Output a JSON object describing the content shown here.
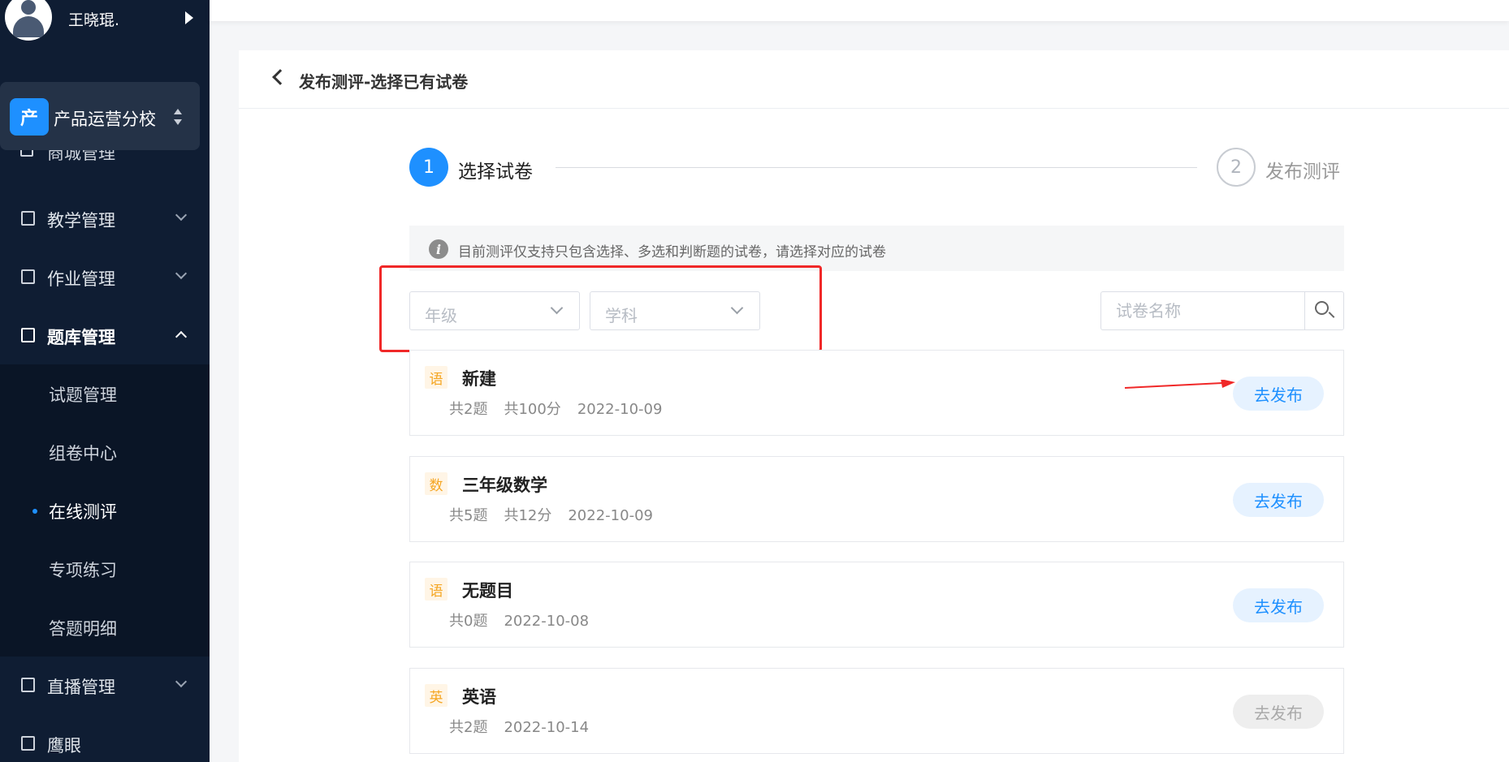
{
  "user": {
    "name": "王晓琨."
  },
  "school": {
    "badge": "产",
    "name": "产品运营分校"
  },
  "sidebar": {
    "cut_item": "商城管理",
    "menus": [
      {
        "label": "教学管理"
      },
      {
        "label": "作业管理"
      },
      {
        "label": "题库管理"
      },
      {
        "label": "直播管理"
      },
      {
        "label": "鹰眼"
      }
    ],
    "submenu": [
      {
        "label": "试题管理"
      },
      {
        "label": "组卷中心"
      },
      {
        "label": "在线测评"
      },
      {
        "label": "专项练习"
      },
      {
        "label": "答题明细"
      }
    ]
  },
  "page": {
    "title": "发布测评-选择已有试卷",
    "steps": [
      {
        "num": "1",
        "label": "选择试卷"
      },
      {
        "num": "2",
        "label": "发布测评"
      }
    ],
    "notice": "目前测评仅支持只包含选择、多选和判断题的试卷，请选择对应的试卷",
    "notice_icon": "i",
    "filters": {
      "grade": "年级",
      "subject": "学科",
      "search_placeholder": "试卷名称"
    }
  },
  "papers": [
    {
      "tag": "语",
      "name": "新建",
      "meta": [
        "共2题",
        "共100分",
        "2022-10-09"
      ],
      "button": "去发布",
      "enabled": true
    },
    {
      "tag": "数",
      "name": "三年级数学",
      "meta": [
        "共5题",
        "共12分",
        "2022-10-09"
      ],
      "button": "去发布",
      "enabled": true
    },
    {
      "tag": "语",
      "name": "无题目",
      "meta": [
        "共0题",
        "2022-10-08"
      ],
      "button": "去发布",
      "enabled": true
    },
    {
      "tag": "英",
      "name": "英语",
      "meta": [
        "共2题",
        "2022-10-14"
      ],
      "button": "去发布",
      "enabled": false
    }
  ],
  "colors": {
    "sidebar_bg": "#0f1d33",
    "accent": "#1e90ff",
    "tag": "#f5a623",
    "annotation": "#f02828"
  }
}
